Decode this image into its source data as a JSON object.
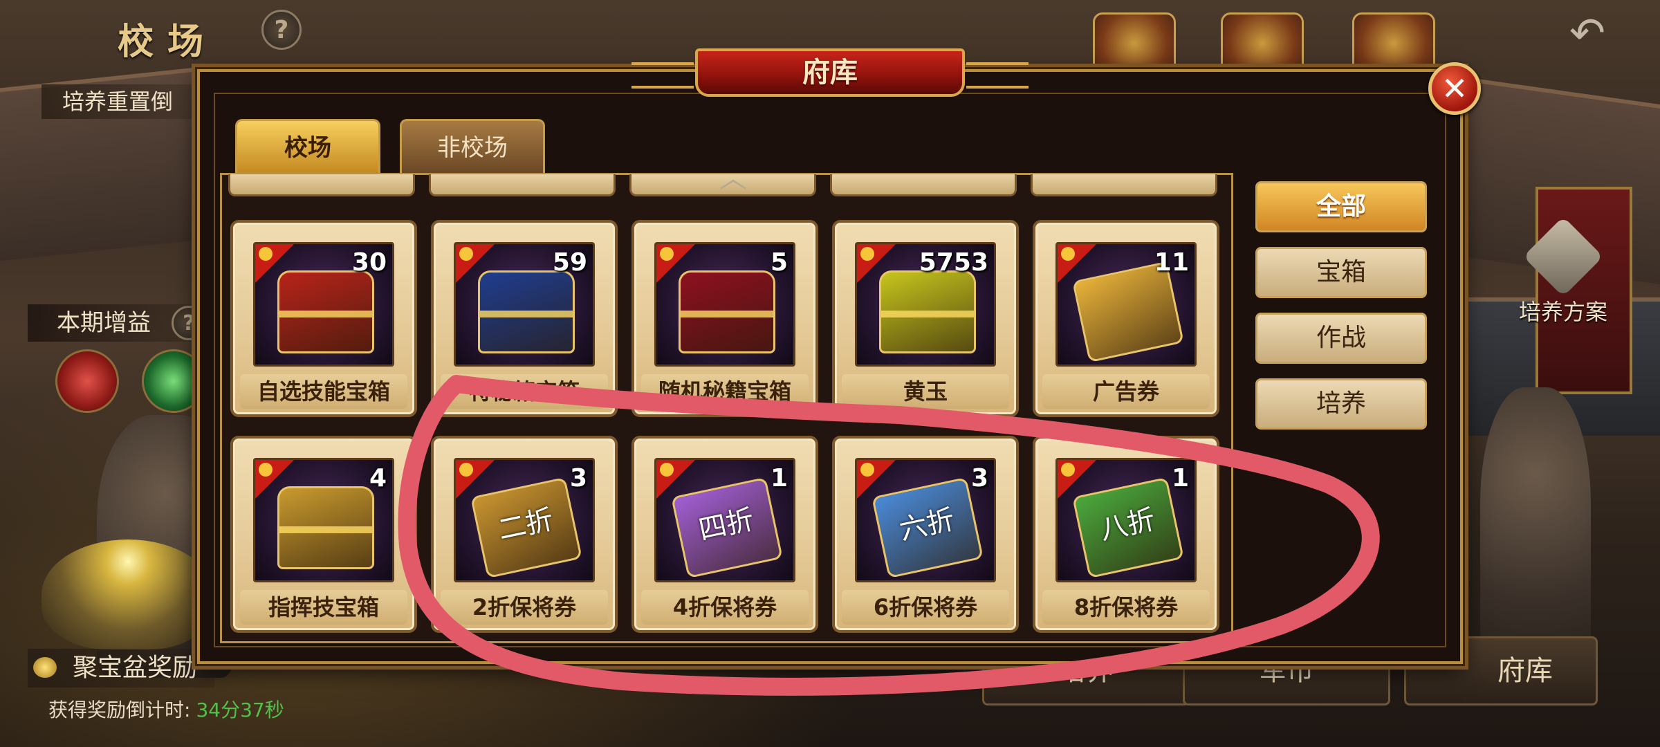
{
  "screen": {
    "title": "校场",
    "help_symbol": "?",
    "back_symbol": "↶",
    "reset_label": "培养重置倒",
    "gain_label": "本期增益",
    "treasure_label": "聚宝盆奖励",
    "countdown_label": "获得奖励倒计时:",
    "countdown_time": "34分37秒",
    "plan_label": "培养方案",
    "nav": {
      "train": "培养",
      "coin": "军币",
      "vault": "府库"
    }
  },
  "modal": {
    "title": "府库",
    "close_symbol": "✕",
    "tabs": [
      {
        "label": "校场",
        "active": true
      },
      {
        "label": "非校场",
        "active": false
      }
    ],
    "scroll_indicator": "︿",
    "filters": [
      {
        "label": "全部",
        "active": true
      },
      {
        "label": "宝箱",
        "active": false
      },
      {
        "label": "作战",
        "active": false
      },
      {
        "label": "培养",
        "active": false
      }
    ],
    "items_row1": [
      {
        "name": "自选技能宝箱",
        "count": "30",
        "icon": "red-gold-chest-icon",
        "color": "#b8231a"
      },
      {
        "name": "特秘籍宝箱",
        "count": "59",
        "icon": "blue-gold-chest-icon",
        "color": "#1f3d8f"
      },
      {
        "name": "随机秘籍宝箱",
        "count": "5",
        "icon": "red-box-icon",
        "color": "#8e1020"
      },
      {
        "name": "黄玉",
        "count": "5753",
        "icon": "yellow-jade-icon",
        "color": "#c6c51e"
      },
      {
        "name": "广告券",
        "count": "11",
        "icon": "ad-ticket-icon",
        "color": "#e8b23a"
      }
    ],
    "items_row2": [
      {
        "name": "指挥技宝箱",
        "count": "4",
        "icon": "gold-chest-icon",
        "color": "#c99a2e"
      },
      {
        "name": "2折保将券",
        "count": "3",
        "icon": "gold-discount-ticket-icon",
        "color": "#c89430",
        "ticket_text": "二折"
      },
      {
        "name": "4折保将券",
        "count": "1",
        "icon": "purple-discount-ticket-icon",
        "color": "#a25fd4",
        "ticket_text": "四折"
      },
      {
        "name": "6折保将券",
        "count": "3",
        "icon": "blue-discount-ticket-icon",
        "color": "#4a8ad8",
        "ticket_text": "六折"
      },
      {
        "name": "8折保将券",
        "count": "1",
        "icon": "green-discount-ticket-icon",
        "color": "#4aa83c",
        "ticket_text": "八折"
      }
    ]
  },
  "annotation_color": "#e25a68"
}
